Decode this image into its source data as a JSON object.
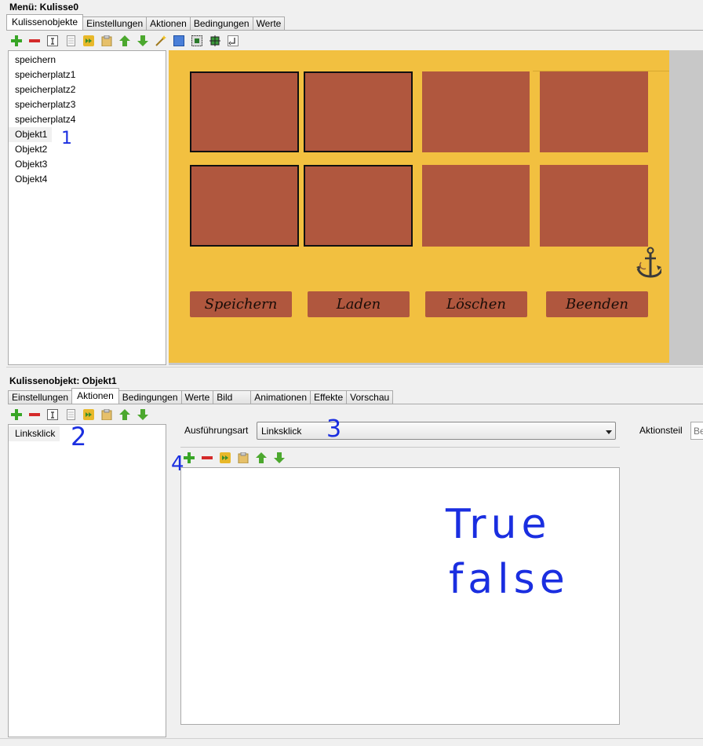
{
  "top": {
    "title": "Menü: Kulisse0",
    "tabs": [
      "Kulissenobjekte",
      "Einstellungen",
      "Aktionen",
      "Bedingungen",
      "Werte"
    ],
    "active_tab": "Kulissenobjekte",
    "toolbar_icons": [
      "add-icon",
      "remove-icon",
      "rename-icon",
      "copy-icon",
      "image-icon",
      "paste-icon",
      "move-up-icon",
      "move-down-icon",
      "wand-icon",
      "select-rect-icon",
      "select-dashed-icon",
      "crosshair-icon",
      "rotate-icon"
    ],
    "objects": [
      "speichern",
      "speicherplatz1",
      "speicherplatz2",
      "speicherplatz3",
      "speicherplatz4",
      "Objekt1",
      "Objekt2",
      "Objekt3",
      "Objekt4"
    ],
    "selected_object": "Objekt1",
    "annotation": "1"
  },
  "preview": {
    "background_color": "#f2c040",
    "card_color": "#b0573e",
    "buttons": [
      "Speichern",
      "Laden",
      "Löschen",
      "Beenden"
    ],
    "anchor_icon": "anchor-icon"
  },
  "bottom": {
    "title": "Kulissenobjekt: Objekt1",
    "tabs": [
      "Einstellungen",
      "Aktionen",
      "Bedingungen",
      "Werte",
      "Bild",
      "Animationen",
      "Effekte",
      "Vorschau"
    ],
    "active_tab": "Aktionen",
    "events": [
      "Linksklick"
    ],
    "execution_label": "Ausführungsart",
    "execution_value": "Linksklick",
    "action_part_label": "Aktionsteil",
    "action_part_placeholder": "Be",
    "annotations": {
      "two": "2",
      "three": "3",
      "four": "4",
      "true_text": "True",
      "false_text": "false"
    }
  }
}
